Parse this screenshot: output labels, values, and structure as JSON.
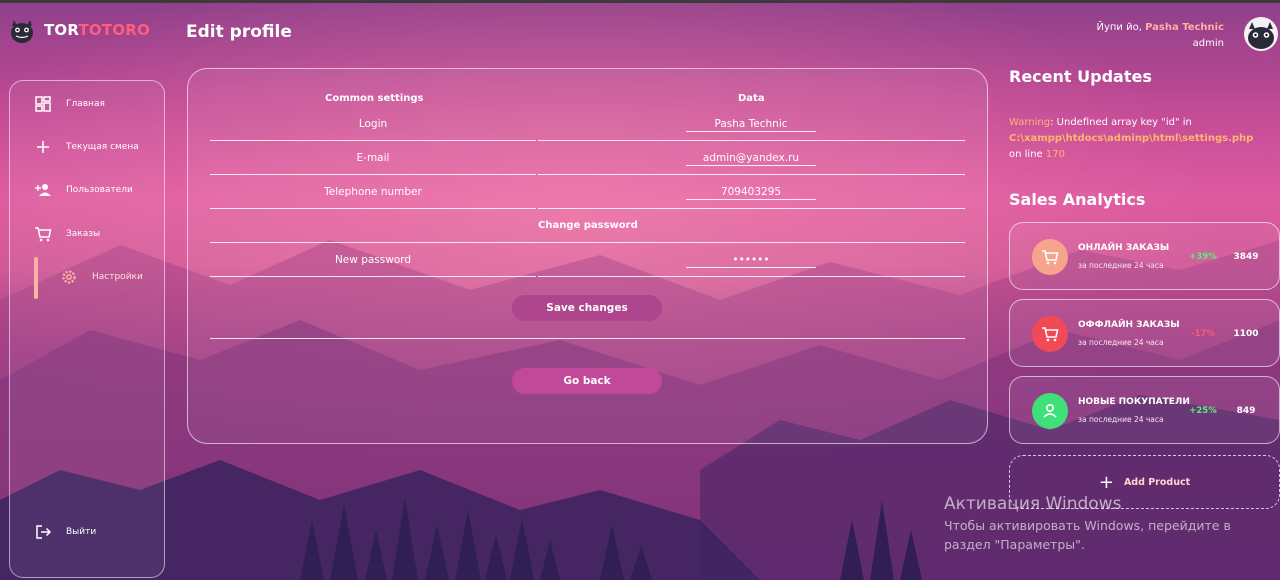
{
  "brand": {
    "name_part1": "TOR",
    "name_part2": "TOTORO",
    "accent_color": "#ff5e7e"
  },
  "header": {
    "title": "Edit profile",
    "greeting": "Йупи йо, ",
    "user_name": "Pasha Technic",
    "user_role": "admin"
  },
  "sidebar": {
    "items": [
      {
        "label": "Главная",
        "icon": "dashboard-icon"
      },
      {
        "label": "Текущая смена",
        "icon": "plus-icon"
      },
      {
        "label": "Пользователи",
        "icon": "person-add-icon"
      },
      {
        "label": "Заказы",
        "icon": "cart-icon"
      },
      {
        "label": "Настройки",
        "icon": "gear-icon",
        "active": true
      }
    ],
    "logout_label": "Выйти"
  },
  "form": {
    "col_left": "Common settings",
    "col_right": "Data",
    "rows": [
      {
        "label": "Login",
        "value": "Pasha Technic"
      },
      {
        "label": "E-mail",
        "value": "admin@yandex.ru"
      },
      {
        "label": "Telephone number",
        "value": "709403295"
      }
    ],
    "password_section": "Change password",
    "new_password_label": "New password",
    "new_password_value": "••••••",
    "save_label": "Save changes",
    "back_label": "Go back"
  },
  "updates": {
    "heading": "Recent Updates",
    "warning_prefix": "Warning",
    "warning_text": ": Undefined array key \"id\" in",
    "warning_path": "C:\\xampp\\htdocs\\adminp\\html\\settings.php",
    "warning_line_prefix": "on line ",
    "warning_line": "170"
  },
  "analytics": {
    "heading": "Sales Analytics",
    "cards": [
      {
        "title": "ОНЛАЙН ЗАКАЗЫ",
        "subtitle": "за последние 24 часа",
        "change": "+39%",
        "value": "3849",
        "icon_color": "#f7a48d",
        "change_color": "#5cf07a",
        "icon": "cart-icon"
      },
      {
        "title": "ОФФЛАЙН ЗАКАЗЫ",
        "subtitle": "за последние 24 часа",
        "change": "-17%",
        "value": "1100",
        "icon_color": "#f04a56",
        "change_color": "#ff5a6a",
        "icon": "cart-icon"
      },
      {
        "title": "НОВЫЕ ПОКУПАТЕЛИ",
        "subtitle": "за последние 24 часа",
        "change": "+25%",
        "value": "849",
        "icon_color": "#3fe07a",
        "change_color": "#5cf07a",
        "icon": "person-icon"
      }
    ],
    "add_product_label": "Add Product"
  },
  "windows_watermark": {
    "title": "Активация Windows",
    "line1": "Чтобы активировать Windows, перейдите в",
    "line2": "раздел \"Параметры\"."
  }
}
